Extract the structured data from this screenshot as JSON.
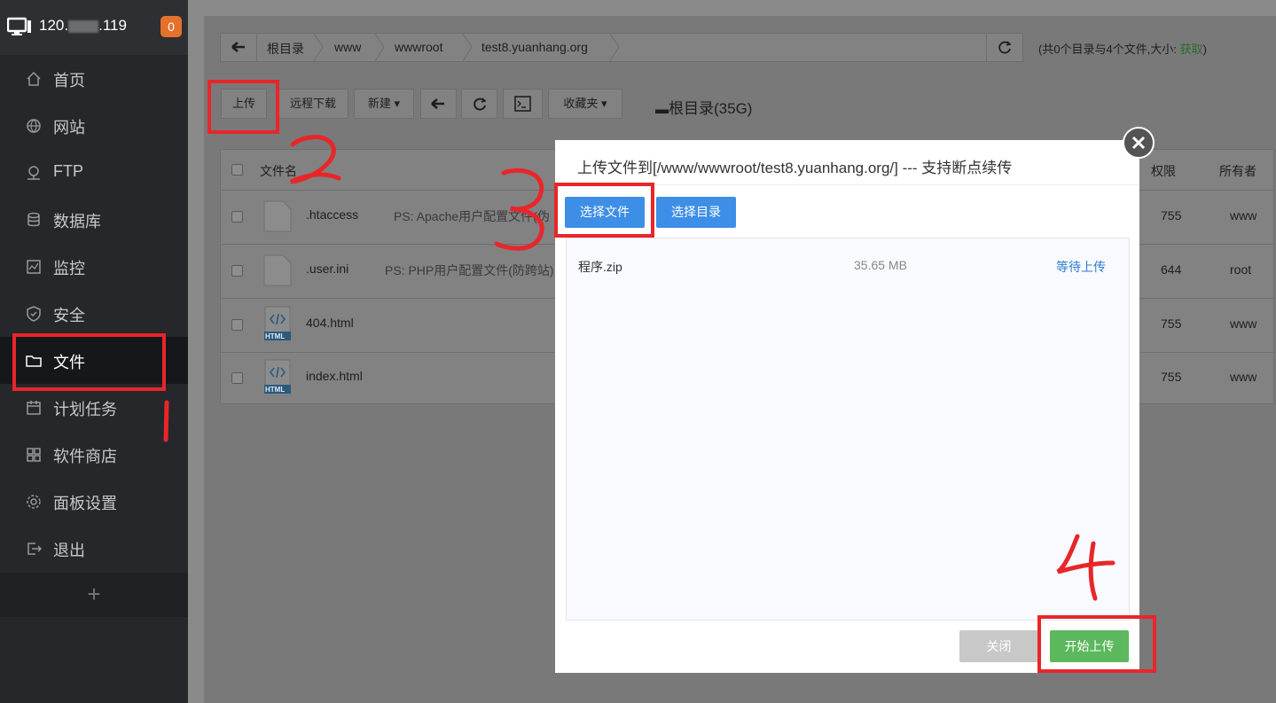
{
  "sidebar": {
    "server_ip_prefix": "120.",
    "server_ip_suffix": ".119",
    "badge": "0",
    "items": [
      {
        "label": "首页",
        "icon": "home-icon"
      },
      {
        "label": "网站",
        "icon": "globe-icon"
      },
      {
        "label": "FTP",
        "icon": "ftp-icon"
      },
      {
        "label": "数据库",
        "icon": "database-icon"
      },
      {
        "label": "监控",
        "icon": "monitor-chart-icon"
      },
      {
        "label": "安全",
        "icon": "shield-icon"
      },
      {
        "label": "文件",
        "icon": "folder-icon",
        "active": true
      },
      {
        "label": "计划任务",
        "icon": "calendar-icon"
      },
      {
        "label": "软件商店",
        "icon": "grid-icon"
      },
      {
        "label": "面板设置",
        "icon": "gear-icon"
      },
      {
        "label": "退出",
        "icon": "logout-icon"
      }
    ],
    "add": "+"
  },
  "path": {
    "segments": [
      "根目录",
      "www",
      "wwwroot",
      "test8.yuanhang.org"
    ],
    "summary_prefix": "(共0个目录与4个文件,大小: ",
    "summary_link": "获取",
    "summary_suffix": ")"
  },
  "toolbar": {
    "upload": "上传",
    "remote_download": "远程下载",
    "new": "新建",
    "favorites": "收藏夹",
    "disk": "根目录(35G)"
  },
  "table": {
    "col_name": "文件名",
    "col_perm": "权限",
    "col_owner": "所有者",
    "rows": [
      {
        "name": ".htaccess",
        "ps": "PS: Apache用户配置文件(伪",
        "perm": "755",
        "owner": "www",
        "type": "file"
      },
      {
        "name": ".user.ini",
        "ps": "PS: PHP用户配置文件(防跨站)",
        "perm": "644",
        "owner": "root",
        "type": "file"
      },
      {
        "name": "404.html",
        "ps": "",
        "perm": "755",
        "owner": "www",
        "type": "html"
      },
      {
        "name": "index.html",
        "ps": "",
        "perm": "755",
        "owner": "www",
        "type": "html"
      }
    ],
    "html_badge": "HTML"
  },
  "dialog": {
    "title": "上传文件到[/www/wwwroot/test8.yuanhang.org/] --- 支持断点续传",
    "select_files": "选择文件",
    "select_dir": "选择目录",
    "files": [
      {
        "name": "程序.zip",
        "size": "35.65 MB",
        "status": "等待上传"
      }
    ],
    "close": "关闭",
    "start": "开始上传"
  },
  "colors": {
    "sidebar_bg": "#25272b",
    "primary_blue": "#3d8ee6",
    "success_green": "#5cb85c",
    "annotation_red": "#e8262a",
    "badge_orange": "#e4712c"
  }
}
